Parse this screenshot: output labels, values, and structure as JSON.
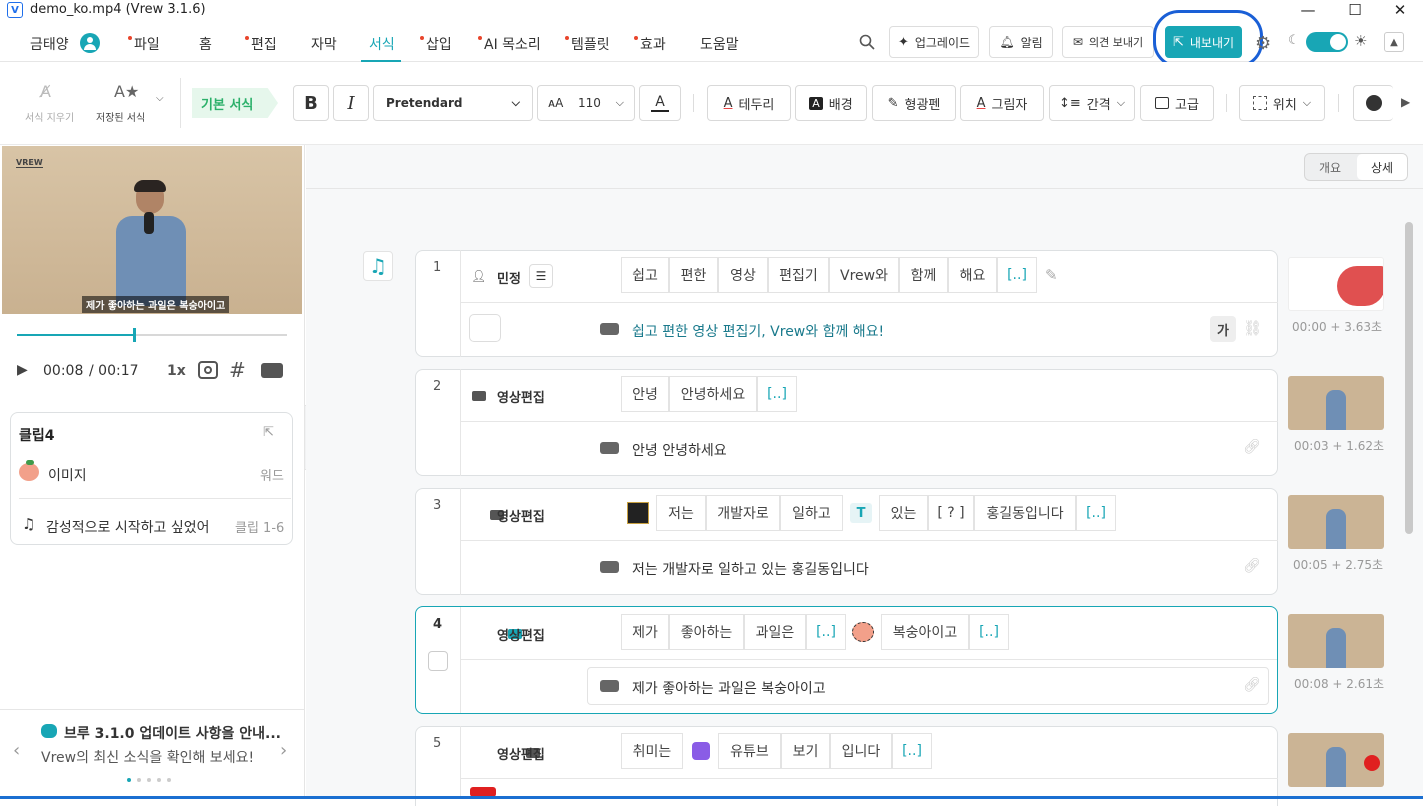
{
  "window": {
    "title": "demo_ko.mp4 (Vrew 3.1.6)",
    "min": "—",
    "max": "☐",
    "close": "✕"
  },
  "menu": {
    "user": "금태양",
    "items": [
      "파일",
      "홈",
      "편집",
      "자막",
      "서식",
      "삽입",
      "AI 목소리",
      "템플릿",
      "효과",
      "도움말"
    ],
    "upgrade": "업그레이드",
    "alerts": "알림",
    "feedback": "의견 보내기",
    "export": "내보내기"
  },
  "toolbar": {
    "clear_style": "서식 지우기",
    "saved_style": "저장된 서식",
    "basic_style": "기본 서식",
    "bold": "B",
    "italic": "I",
    "font": "Pretendard",
    "size": "110",
    "color_letter": "A",
    "outline": "테두리",
    "bg": "배경",
    "highlight": "형광펜",
    "shadow": "그림자",
    "spacing": "간격",
    "advanced": "고급",
    "position": "위치"
  },
  "view_toggle": {
    "overview": "개요",
    "detail": "상세"
  },
  "player": {
    "watermark": "VREW",
    "subtitle": "제가 좋아하는 과일은 복숭아이고",
    "time_current": "00:08",
    "time_total": "/ 00:17",
    "speed": "1x",
    "progress": 0.43
  },
  "clip_panel": {
    "title": "클립4",
    "rows": [
      {
        "label": "이미지",
        "right": "워드"
      },
      {
        "label": "감성적으로 시작하고 싶었어",
        "right": "클립 1-6"
      }
    ]
  },
  "news": {
    "title": "브루 3.1.0 업데이트 사항을 안내...",
    "body": "Vrew의 최신 소식을 확인해 보세요!",
    "prev": "‹",
    "next": "›"
  },
  "clips": [
    {
      "num": "1",
      "speaker": "민정",
      "words": [
        "쉽고",
        "편한",
        "영상",
        "편집기",
        "Vrew와",
        "함께",
        "해요",
        "[..]"
      ],
      "sentence": "쉽고 편한 영상 편집기, Vrew와 함께 해요!",
      "time": "00:00 + 3.63초",
      "ga": "가"
    },
    {
      "num": "2",
      "speaker": "영상편집",
      "words": [
        "안녕",
        "안녕하세요",
        "[..]"
      ],
      "sentence": "안녕 안녕하세요",
      "time": "00:03 + 1.62초"
    },
    {
      "num": "3",
      "speaker": "영상편집",
      "words": [
        "저는",
        "개발자로",
        "일하고",
        "있는",
        "[ ? ]",
        "홍길동입니다",
        "[..]"
      ],
      "sentence": "저는 개발자로 일하고 있는 홍길동입니다",
      "time": "00:05 + 2.75초"
    },
    {
      "num": "4",
      "speaker": "영상편집",
      "words": [
        "제가",
        "좋아하는",
        "과일은",
        "[..]",
        "복숭아이고",
        "[..]"
      ],
      "sentence": "제가 좋아하는 과일은 복숭아이고",
      "time": "00:08 + 2.61초"
    },
    {
      "num": "5",
      "speaker": "영상편집",
      "words": [
        "취미는",
        "유튜브",
        "보기",
        "입니다",
        "[..]"
      ],
      "sentence": "",
      "time": ""
    }
  ]
}
